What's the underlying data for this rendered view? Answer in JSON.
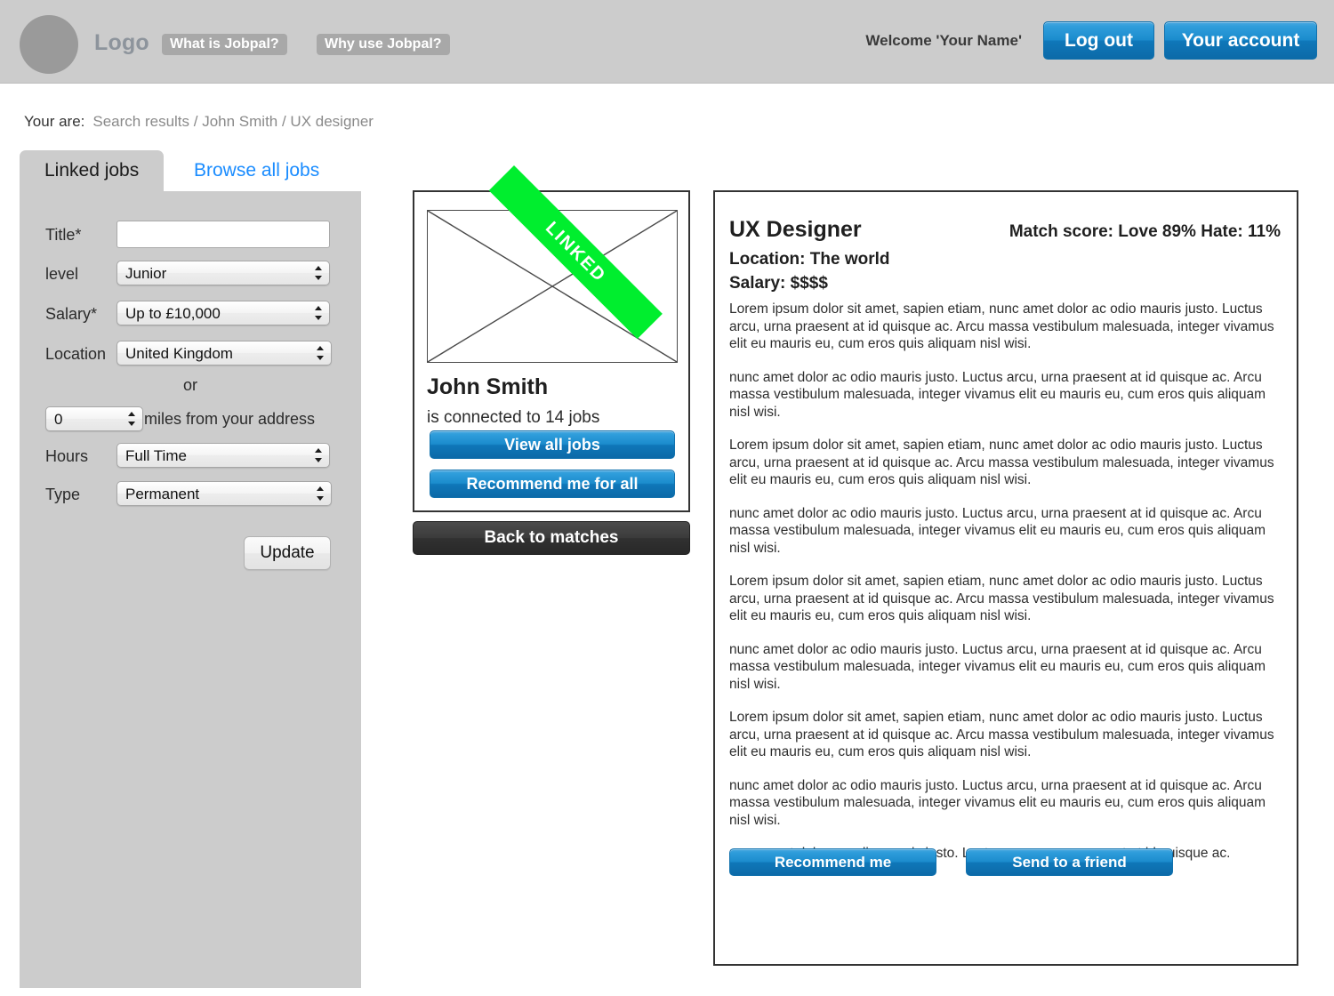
{
  "header": {
    "logo_text": "Logo",
    "nav": [
      {
        "label": "What is Jobpal?"
      },
      {
        "label": "Why use Jobpal?"
      }
    ],
    "welcome": "Welcome 'Your Name'",
    "logout_label": "Log out",
    "account_label": "Your account",
    "bg_color": "#cccccc",
    "accent_color": "#1b8ccd"
  },
  "breadcrumb": {
    "label": "Your are:",
    "path": "Search results / John Smith / UX designer"
  },
  "tabs": [
    {
      "label": "Linked jobs",
      "active": true
    },
    {
      "label": "Browse all jobs",
      "active": false
    }
  ],
  "filters": {
    "title": {
      "label": "Title*",
      "value": "",
      "placeholder": ""
    },
    "level": {
      "label": "level",
      "value": "Junior"
    },
    "salary": {
      "label": "Salary*",
      "value": "Up to £10,000"
    },
    "location": {
      "label": "Location",
      "value": "United Kingdom"
    },
    "or_text": "or",
    "miles": {
      "value": "0",
      "suffix": "miles from your address"
    },
    "hours": {
      "label": "Hours",
      "value": "Full Time"
    },
    "type": {
      "label": "Type",
      "value": "Permanent"
    },
    "update_label": "Update"
  },
  "profile": {
    "ribbon": "LINKED",
    "name": "John Smith",
    "subtitle": "is connected to 14 jobs",
    "view_all_label": "View all jobs",
    "recommend_all_label": "Recommend me for all",
    "back_label": "Back to matches",
    "ribbon_color": "#00ee2e"
  },
  "job": {
    "title": "UX Designer",
    "match_score": "Match score: Love 89% Hate: 11%",
    "location": "Location: The world",
    "salary": "Salary: $$$$",
    "paragraphs": [
      "Lorem ipsum dolor sit amet, sapien etiam, nunc amet dolor ac odio mauris justo. Luctus arcu, urna praesent at id quisque ac. Arcu massa vestibulum malesuada, integer vivamus elit eu mauris eu, cum eros quis aliquam nisl wisi.",
      "nunc amet dolor ac odio mauris justo. Luctus arcu, urna praesent at id quisque ac. Arcu massa vestibulum malesuada, integer vivamus elit eu mauris eu, cum eros quis aliquam nisl wisi.",
      "Lorem ipsum dolor sit amet, sapien etiam, nunc amet dolor ac odio mauris justo. Luctus arcu, urna praesent at id quisque ac. Arcu massa vestibulum malesuada, integer vivamus elit eu mauris eu, cum eros quis aliquam nisl wisi.",
      "nunc amet dolor ac odio mauris justo. Luctus arcu, urna praesent at id quisque ac. Arcu massa vestibulum malesuada, integer vivamus elit eu mauris eu, cum eros quis aliquam nisl wisi.",
      "Lorem ipsum dolor sit amet, sapien etiam, nunc amet dolor ac odio mauris justo. Luctus arcu, urna praesent at id quisque ac. Arcu massa vestibulum malesuada, integer vivamus elit eu mauris eu, cum eros quis aliquam nisl wisi.",
      "nunc amet dolor ac odio mauris justo. Luctus arcu, urna praesent at id quisque ac. Arcu massa vestibulum malesuada, integer vivamus elit eu mauris eu, cum eros quis aliquam nisl wisi.",
      "Lorem ipsum dolor sit amet, sapien etiam, nunc amet dolor ac odio mauris justo. Luctus arcu, urna praesent at id quisque ac. Arcu massa vestibulum malesuada, integer vivamus elit eu mauris eu, cum eros quis aliquam nisl wisi.",
      "nunc amet dolor ac odio mauris justo. Luctus arcu, urna praesent at id quisque ac. Arcu massa vestibulum malesuada, integer vivamus elit eu mauris eu, cum eros quis aliquam nisl wisi.",
      "nunc amet dolor ac odio mauris justo. Luctus arcu, urna praesent at id quisque ac."
    ],
    "recommend_label": "Recommend me",
    "send_label": "Send to a friend"
  }
}
